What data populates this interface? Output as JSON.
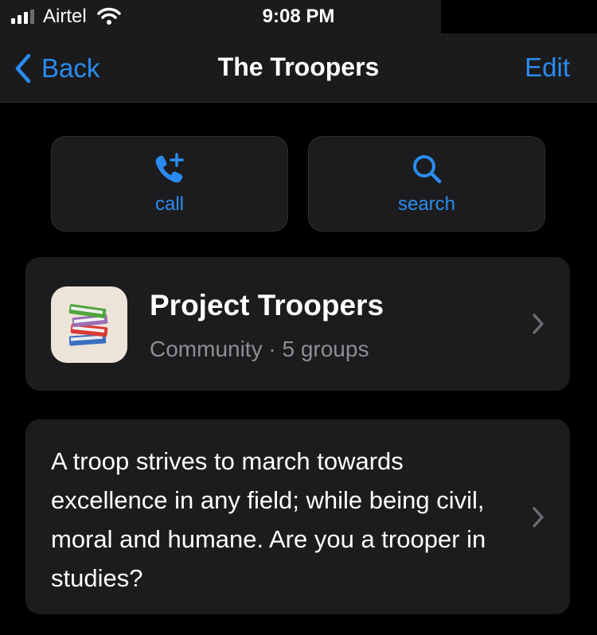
{
  "status_bar": {
    "carrier": "Airtel",
    "time": "9:08 PM",
    "signal_bars": 3,
    "signal_icon": "signal-bars-icon",
    "wifi_icon": "wifi-icon"
  },
  "nav": {
    "back_label": "Back",
    "title": "The Troopers",
    "edit_label": "Edit"
  },
  "actions": [
    {
      "label": "call",
      "icon": "phone-plus-icon"
    },
    {
      "label": "search",
      "icon": "search-icon"
    }
  ],
  "community": {
    "name": "Project Troopers",
    "type": "Community",
    "separator": "·",
    "group_count": "5 groups",
    "icon": "books-icon"
  },
  "description": {
    "text": "A troop strives to march towards excellence in any field; while being civil, moral and humane. Are you a trooper in studies?"
  },
  "colors": {
    "accent": "#2a8cf0",
    "background": "#000000",
    "card": "#1c1c1e",
    "secondary_text": "#8e8e93"
  }
}
